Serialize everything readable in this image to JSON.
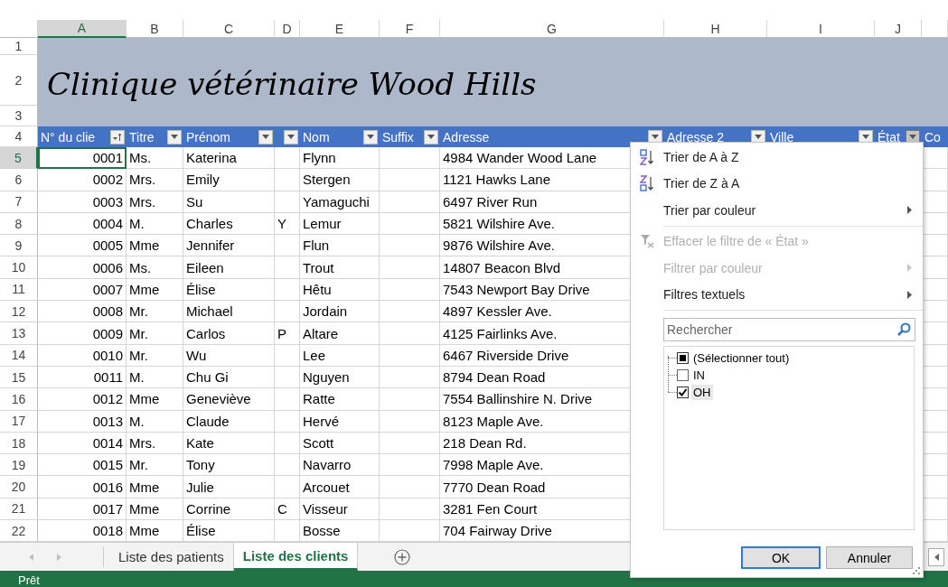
{
  "columns": [
    {
      "letter": "A",
      "selected": true
    },
    {
      "letter": "B",
      "selected": false
    },
    {
      "letter": "C",
      "selected": false
    },
    {
      "letter": "D",
      "selected": false
    },
    {
      "letter": "E",
      "selected": false
    },
    {
      "letter": "F",
      "selected": false
    },
    {
      "letter": "G",
      "selected": false
    },
    {
      "letter": "H",
      "selected": false
    },
    {
      "letter": "I",
      "selected": false
    },
    {
      "letter": "J",
      "selected": false
    }
  ],
  "banner": {
    "rows": [
      "1",
      "2",
      "3"
    ],
    "title": "Clinique vétérinaire Wood Hills"
  },
  "header_row": {
    "row": "4",
    "cells": [
      {
        "text": "N° du clie",
        "filter": {
          "sorted": true,
          "open": false
        }
      },
      {
        "text": "Titre",
        "filter": {
          "sorted": false,
          "open": false
        }
      },
      {
        "text": "Prénom",
        "filter": {
          "sorted": false,
          "open": false
        }
      },
      {
        "filter": {
          "sorted": false,
          "open": false
        }
      },
      {
        "text": "Nom",
        "filter": {
          "sorted": false,
          "open": false
        }
      },
      {
        "text": "Suffix",
        "filter": {
          "sorted": false,
          "open": false
        }
      },
      {
        "text": "Adresse",
        "filter": {
          "sorted": false,
          "open": false
        }
      },
      {
        "text": "Adresse 2",
        "filter": {
          "sorted": false,
          "open": false
        }
      },
      {
        "text": "Ville",
        "filter": {
          "sorted": false,
          "open": false
        }
      },
      {
        "text": "État",
        "filter": {
          "sorted": false,
          "open": true
        }
      },
      {
        "text": "Co"
      }
    ]
  },
  "rows": [
    {
      "row": "5",
      "selected": true,
      "id": "0001",
      "title": "Ms.",
      "first_name": "Katerina",
      "last_name": "Flynn",
      "address": "4984 Wander Wood Lane"
    },
    {
      "row": "6",
      "selected": false,
      "id": "0002",
      "title": "Mrs.",
      "first_name": "Emily",
      "last_name": "Stergen",
      "address": "1121 Hawks Lane"
    },
    {
      "row": "7",
      "selected": false,
      "id": "0003",
      "title": "Mrs.",
      "first_name": "Su",
      "last_name": "Yamaguchi",
      "address": "6497 River Run"
    },
    {
      "row": "8",
      "selected": false,
      "id": "0004",
      "title": "M.",
      "first_name": "Charles",
      "middle_initial": "Y",
      "last_name": "Lemur",
      "address": "5821 Wilshire Ave."
    },
    {
      "row": "9",
      "selected": false,
      "id": "0005",
      "title": "Mme",
      "first_name": "Jennifer",
      "last_name": "Flun",
      "address": "9876 Wilshire Ave."
    },
    {
      "row": "10",
      "selected": false,
      "id": "0006",
      "title": "Ms.",
      "first_name": "Eileen",
      "last_name": "Trout",
      "address": "14807 Beacon Blvd"
    },
    {
      "row": "11",
      "selected": false,
      "id": "0007",
      "title": "Mme",
      "first_name": "Élise",
      "last_name": "Hêtu",
      "address": "7543 Newport Bay Drive"
    },
    {
      "row": "12",
      "selected": false,
      "id": "0008",
      "title": "Mr.",
      "first_name": "Michael",
      "last_name": "Jordain",
      "address": "4897 Kessler Ave."
    },
    {
      "row": "13",
      "selected": false,
      "id": "0009",
      "title": "Mr.",
      "first_name": "Carlos",
      "middle_initial": "P",
      "last_name": "Altare",
      "address": "4125 Fairlinks Ave."
    },
    {
      "row": "14",
      "selected": false,
      "id": "0010",
      "title": "Mr.",
      "first_name": "Wu",
      "last_name": "Lee",
      "address": "6467 Riverside Drive"
    },
    {
      "row": "15",
      "selected": false,
      "id": "0011",
      "title": "M.",
      "first_name": "Chu Gi",
      "last_name": "Nguyen",
      "address": "8794 Dean Road"
    },
    {
      "row": "16",
      "selected": false,
      "id": "0012",
      "title": "Mme",
      "first_name": "Geneviève",
      "last_name": "Ratte",
      "address": "7554 Ballinshire N. Drive"
    },
    {
      "row": "17",
      "selected": false,
      "id": "0013",
      "title": "M.",
      "first_name": "Claude",
      "last_name": "Hervé",
      "address": "8123 Maple Ave."
    },
    {
      "row": "18",
      "selected": false,
      "id": "0014",
      "title": "Mrs.",
      "first_name": "Kate",
      "last_name": "Scott",
      "address": "218 Dean Rd."
    },
    {
      "row": "19",
      "selected": false,
      "id": "0015",
      "title": "Mr.",
      "first_name": "Tony",
      "last_name": "Navarro",
      "address": "7998 Maple Ave."
    },
    {
      "row": "20",
      "selected": false,
      "id": "0016",
      "title": "Mme",
      "first_name": "Julie",
      "last_name": "Arcouet",
      "address": "7770 Dean Road"
    },
    {
      "row": "21",
      "selected": false,
      "id": "0017",
      "title": "Mme",
      "first_name": "Corrine",
      "middle_initial": "C",
      "last_name": "Visseur",
      "address": "3281 Fen Court"
    },
    {
      "row": "22",
      "selected": false,
      "id": "0018",
      "title": "Mme",
      "first_name": "Élise",
      "last_name": "Bosse",
      "address": "704 Fairway Drive"
    }
  ],
  "sheet_tabs": [
    {
      "label": "Liste des patients",
      "selected": false
    },
    {
      "label": "Liste des clients",
      "selected": true
    }
  ],
  "status_bar": {
    "text": "Prêt"
  },
  "filter_menu": {
    "sections": [
      [
        {
          "label": "Trier de A à Z",
          "kind": "sort-asc",
          "disabled": false
        },
        {
          "label": "Trier de Z à A",
          "kind": "sort-desc",
          "disabled": false
        },
        {
          "label": "Trier par couleur",
          "kind": "submenu",
          "disabled": false
        }
      ],
      [
        {
          "label": "Effacer le filtre de « État »",
          "kind": "clear-filter",
          "disabled": true
        },
        {
          "label": "Filtrer par couleur",
          "kind": "submenu",
          "disabled": true
        },
        {
          "label": "Filtres textuels",
          "kind": "submenu",
          "disabled": false
        }
      ]
    ],
    "search": {
      "placeholder": "Rechercher"
    },
    "values": [
      {
        "label": "(Sélectionner tout)",
        "checked": false,
        "mixed": true,
        "selected": false
      },
      {
        "label": "IN",
        "checked": false,
        "mixed": false,
        "selected": false
      },
      {
        "label": "OH",
        "checked": true,
        "mixed": false,
        "selected": true
      }
    ],
    "buttons": [
      {
        "label": "OK",
        "default": true
      },
      {
        "label": "Annuler",
        "default": false
      }
    ]
  }
}
